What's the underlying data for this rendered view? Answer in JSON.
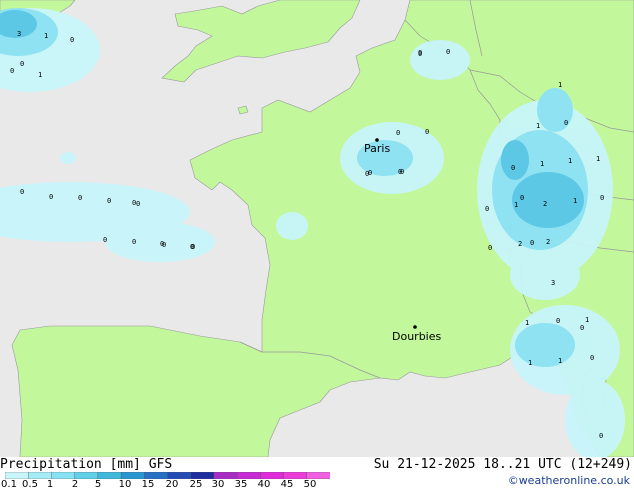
{
  "map": {
    "cities": [
      {
        "name": "Paris"
      },
      {
        "name": "Dourbies"
      }
    ],
    "precip_values": [
      "3",
      "1",
      "0",
      "0",
      "1",
      "0",
      "0",
      "0",
      "0",
      "0",
      "0",
      "0",
      "0",
      "0",
      "0",
      "0",
      "0",
      "0",
      "0",
      "0",
      "1",
      "1",
      "0",
      "0",
      "1",
      "1",
      "1",
      "0",
      "1",
      "2",
      "1",
      "0",
      "0",
      "2",
      "2",
      "3",
      "1",
      "0",
      "1",
      "1",
      "1",
      "0",
      "0",
      "0",
      "0",
      "0",
      "0",
      "0",
      "0",
      "0",
      "0",
      "0",
      "0"
    ]
  },
  "footer": {
    "title": "Precipitation [mm] GFS",
    "run": "Su 21-12-2025 18..21 UTC (12+249)",
    "credit": "©weatheronline.co.uk"
  },
  "legend": {
    "ticks": [
      "0.1",
      "0.5",
      "1",
      "2",
      "5",
      "10",
      "15",
      "20",
      "25",
      "30",
      "35",
      "40",
      "45",
      "50"
    ],
    "colors": [
      "#c8f5fa",
      "#a6ecf6",
      "#86e2f2",
      "#62cfe8",
      "#3fb8dc",
      "#2a95d0",
      "#2770c4",
      "#254cb4",
      "#1f2ca0",
      "#a82cc4",
      "#c62cd4",
      "#de2cd8",
      "#ea3cd8",
      "#f060e0"
    ]
  },
  "colors": {
    "sea": "#e9e9e9",
    "land": "#c2f79c",
    "precip_light": "#c8f5fa",
    "precip_mid": "#8ee2f2",
    "precip_heavy": "#5cc8e6",
    "border": "#999999"
  }
}
